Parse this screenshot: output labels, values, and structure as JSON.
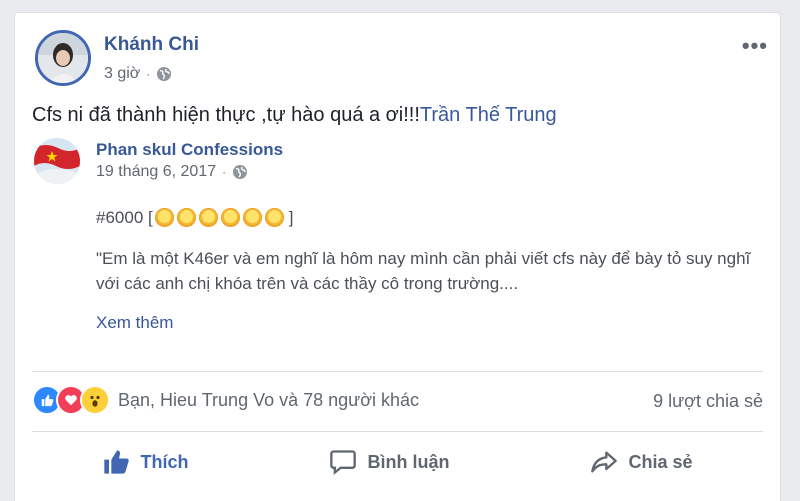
{
  "post": {
    "author": "Khánh Chi",
    "time": "3 giờ",
    "separator": "·",
    "more_icon": "•••",
    "text": "Cfs ni đã thành hiện thực ,tự hào quá a ơi!!!",
    "tag": "Trần Thế Trung"
  },
  "shared": {
    "page_name": "Phan skul Confessions",
    "date": "19 tháng 6, 2017",
    "separator": "·",
    "hash": "#6000 [",
    "hash_close": "]",
    "sun_count": 6,
    "excerpt": "\"Em là một K46er và em nghĩ là hôm nay mình cần phải viết cfs này để bày tỏ suy nghĩ với các anh chị khóa trên và các thầy cô trong trường....",
    "see_more": "Xem thêm"
  },
  "reactions": {
    "text": "Bạn, Hieu Trung Vo và 78 người khác",
    "shares": "9 lượt chia sẻ",
    "icons": [
      "like-icon",
      "love-icon",
      "wow-icon"
    ]
  },
  "actions": {
    "like": "Thích",
    "comment": "Bình luận",
    "share": "Chia sẻ"
  },
  "colors": {
    "link": "#385898",
    "like_active": "#4267b2",
    "love": "#f33e58",
    "wow": "#fdd03a"
  }
}
